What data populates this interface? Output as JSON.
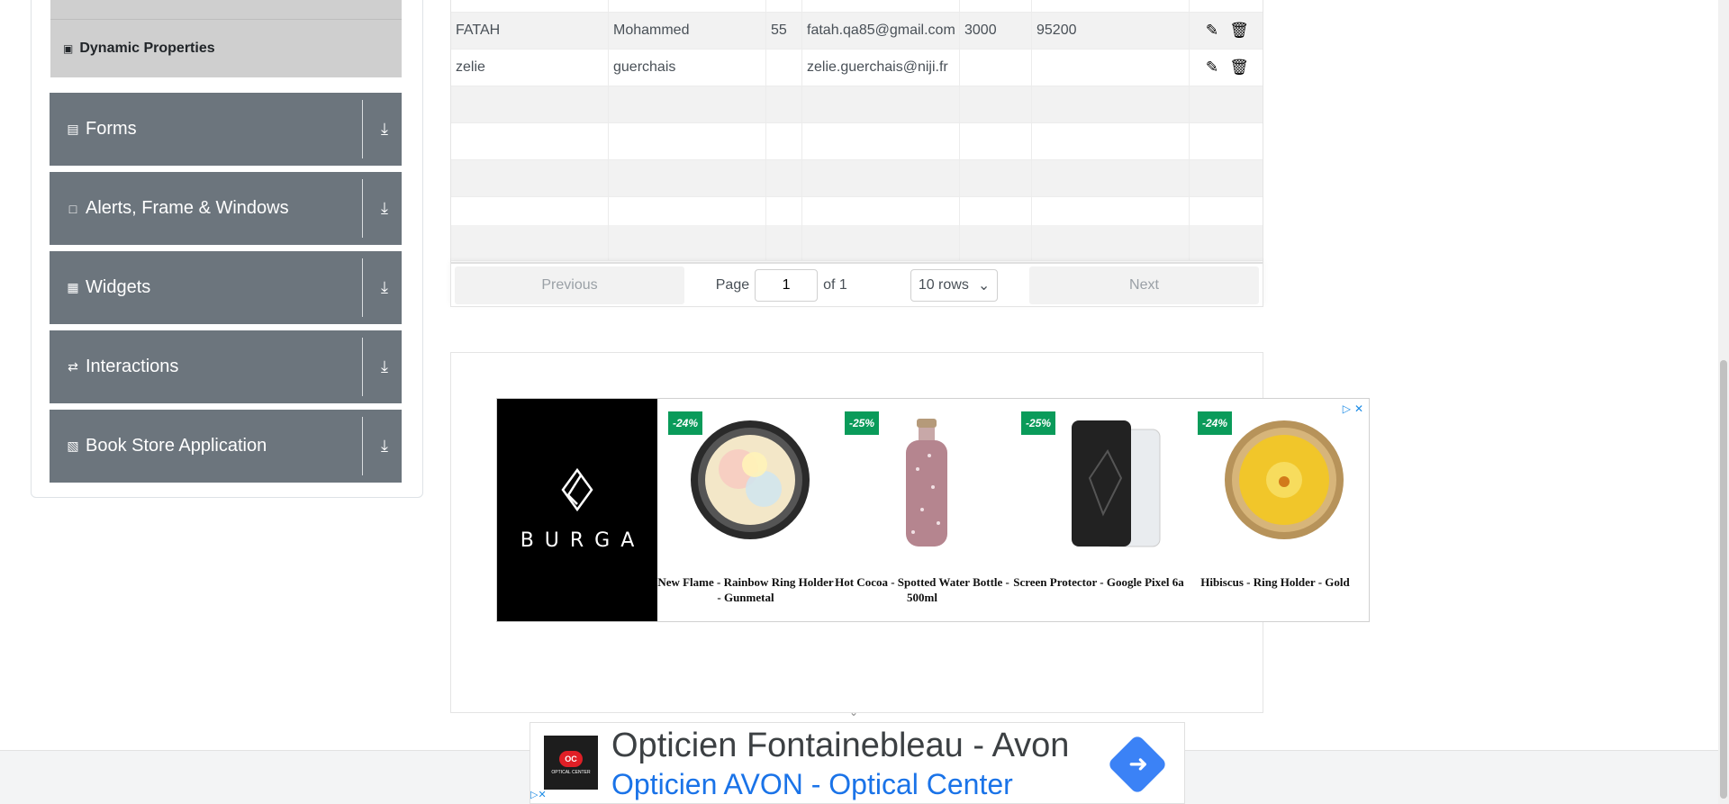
{
  "sidebar": {
    "active_item": {
      "label": "Dynamic Properties",
      "icon": "html5-icon"
    },
    "groups": [
      {
        "label": "Forms",
        "icon": "form-icon"
      },
      {
        "label": "Alerts, Frame & Windows",
        "icon": "window-icon"
      },
      {
        "label": "Widgets",
        "icon": "widgets-icon"
      },
      {
        "label": "Interactions",
        "icon": "interactions-icon"
      },
      {
        "label": "Book Store Application",
        "icon": "books-icon"
      }
    ]
  },
  "table": {
    "rows": [
      {
        "first_name": "FATAH",
        "last_name": "Mohammed",
        "age": "55",
        "email": "fatah.qa85@gmail.com",
        "salary": "3000",
        "department": "95200"
      },
      {
        "first_name": "zelie",
        "last_name": "guerchais",
        "age": "",
        "email": "zelie.guerchais@niji.fr",
        "salary": "",
        "department": ""
      }
    ]
  },
  "pagination": {
    "previous_label": "Previous",
    "next_label": "Next",
    "page_label": "Page",
    "page_value": "1",
    "of_label": "of 1",
    "rows_label": "10 rows"
  },
  "burga_ad": {
    "brand": "BURGA",
    "products": [
      {
        "discount": "-24%",
        "name": "New Flame - Rainbow Ring Holder - Gunmetal"
      },
      {
        "discount": "-25%",
        "name": "Hot Cocoa - Spotted Water Bottle - 500ml"
      },
      {
        "discount": "-25%",
        "name": "Screen Protector - Google Pixel 6a"
      },
      {
        "discount": "-24%",
        "name": "Hibiscus - Ring Holder - Gold"
      }
    ]
  },
  "bottom_ad": {
    "title": "Opticien Fontainebleau - Avon",
    "subtitle": "Opticien AVON - Optical Center",
    "logo_text": "OPTICAL CENTER"
  },
  "colors": {
    "sidebar_group_bg": "#6c757d",
    "discount_badge": "#0a9b5a",
    "ad_link": "#1a73e8"
  }
}
